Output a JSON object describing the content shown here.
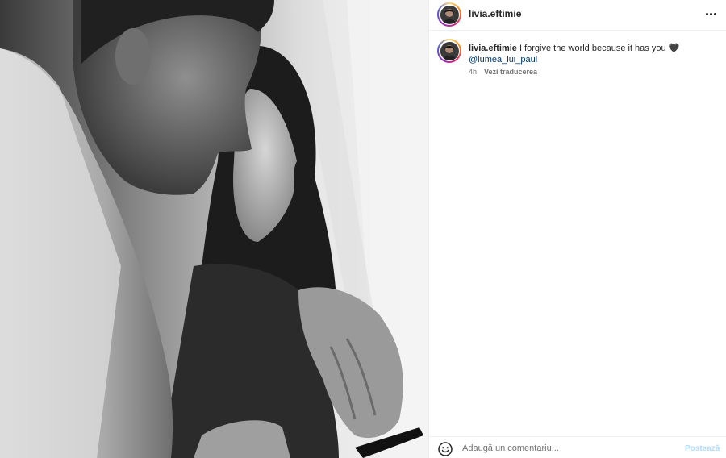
{
  "post": {
    "username": "livia.eftimie",
    "photo_alt": "Black and white photo of a couple embracing"
  },
  "caption": {
    "username": "livia.eftimie",
    "text": "I forgive the world because it has you",
    "emoji": "🖤",
    "mention": "@lumea_lui_paul",
    "time": "4h",
    "translate_label": "Vezi traducerea"
  },
  "comment_box": {
    "placeholder": "Adaugă un comentariu...",
    "post_label": "Postează"
  },
  "icons": {
    "more": "more-horizontal-icon",
    "emoji": "emoji-smile-icon"
  },
  "colors": {
    "link": "#00376b",
    "post_button_disabled": "#b3dbff",
    "muted_text": "#737373"
  }
}
